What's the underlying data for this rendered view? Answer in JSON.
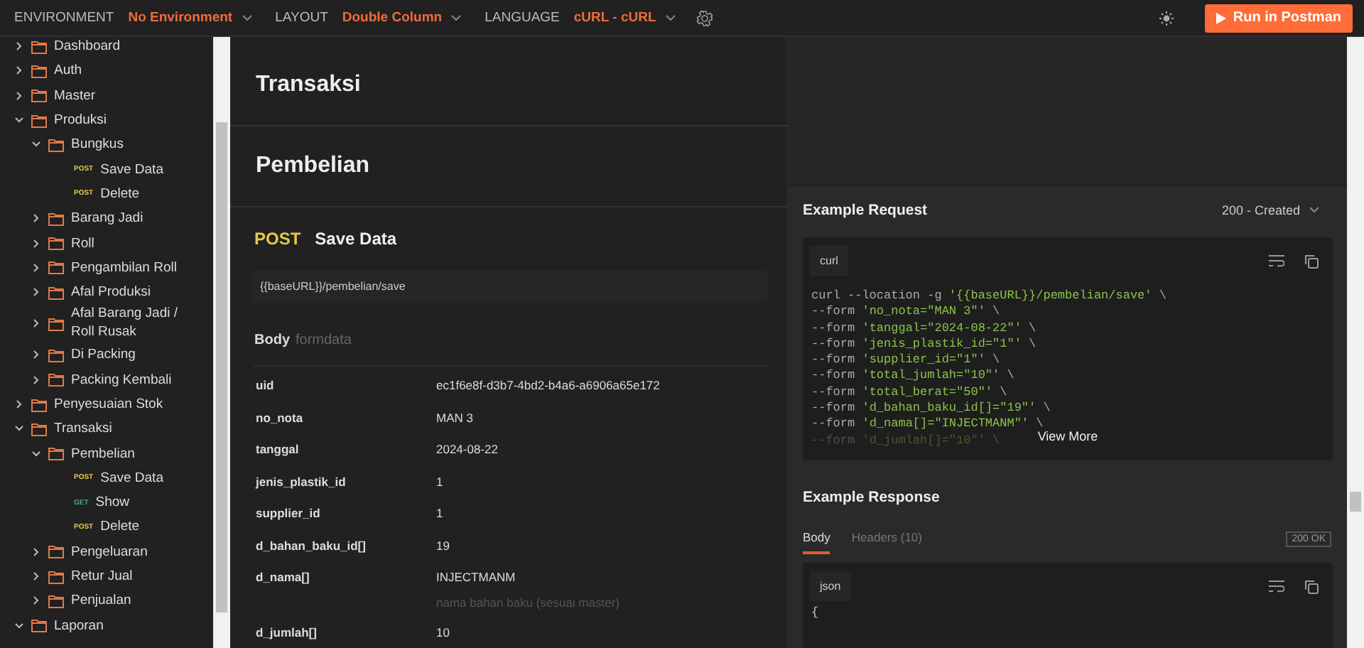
{
  "topbar": {
    "settings": [
      {
        "label": "ENVIRONMENT",
        "value": "No Environment"
      },
      {
        "label": "LAYOUT",
        "value": "Double Column"
      },
      {
        "label": "LANGUAGE",
        "value": "cURL - cURL"
      }
    ],
    "run_button": "Run in Postman"
  },
  "sidebar": {
    "items": [
      {
        "kind": "folder",
        "label": "Dashboard",
        "expanded": false
      },
      {
        "kind": "folder",
        "label": "Auth",
        "expanded": false
      },
      {
        "kind": "folder",
        "label": "Master",
        "expanded": false
      },
      {
        "kind": "folder",
        "label": "Produksi",
        "expanded": true,
        "children": [
          {
            "kind": "folder",
            "label": "Bungkus",
            "expanded": true,
            "children": [
              {
                "kind": "request",
                "method": "POST",
                "label": "Save Data"
              },
              {
                "kind": "request",
                "method": "POST",
                "label": "Delete"
              }
            ]
          },
          {
            "kind": "folder",
            "label": "Barang Jadi",
            "expanded": false
          },
          {
            "kind": "folder",
            "label": "Roll",
            "expanded": false
          },
          {
            "kind": "folder",
            "label": "Pengambilan Roll",
            "expanded": false
          },
          {
            "kind": "folder",
            "label": "Afal Produksi",
            "expanded": false
          },
          {
            "kind": "folder",
            "label": "Afal Barang Jadi / Roll Rusak",
            "expanded": false
          },
          {
            "kind": "folder",
            "label": "Di Packing",
            "expanded": false
          },
          {
            "kind": "folder",
            "label": "Packing Kembali",
            "expanded": false
          }
        ]
      },
      {
        "kind": "folder",
        "label": "Penyesuaian Stok",
        "expanded": false
      },
      {
        "kind": "folder",
        "label": "Transaksi",
        "expanded": true,
        "children": [
          {
            "kind": "folder",
            "label": "Pembelian",
            "expanded": true,
            "children": [
              {
                "kind": "request",
                "method": "POST",
                "label": "Save Data"
              },
              {
                "kind": "request",
                "method": "GET",
                "label": "Show"
              },
              {
                "kind": "request",
                "method": "POST",
                "label": "Delete"
              }
            ]
          },
          {
            "kind": "folder",
            "label": "Pengeluaran",
            "expanded": false
          },
          {
            "kind": "folder",
            "label": "Retur Jual",
            "expanded": false
          },
          {
            "kind": "folder",
            "label": "Penjualan",
            "expanded": false
          }
        ]
      },
      {
        "kind": "folder",
        "label": "Laporan",
        "expanded": true
      }
    ]
  },
  "main": {
    "sections": [
      "Transaksi",
      "Pembelian"
    ],
    "request": {
      "method": "POST",
      "name": "Save Data",
      "url": "{{baseURL}}/pembelian/save",
      "body_label": "Body",
      "body_type": "formdata",
      "params": [
        {
          "key": "uid",
          "value": "ec1f6e8f-d3b7-4bd2-b4a6-a6906a65e172"
        },
        {
          "key": "no_nota",
          "value": "MAN 3"
        },
        {
          "key": "tanggal",
          "value": "2024-08-22"
        },
        {
          "key": "jenis_plastik_id",
          "value": "1"
        },
        {
          "key": "supplier_id",
          "value": "1"
        },
        {
          "key": "d_bahan_baku_id[]",
          "value": "19"
        },
        {
          "key": "d_nama[]",
          "value": "INJECTMANM",
          "description": "nama bahan baku (sesuai master)"
        },
        {
          "key": "d_jumlah[]",
          "value": "10"
        }
      ]
    }
  },
  "example_request": {
    "title": "Example Request",
    "response_select": "200 - Created",
    "language": "curl",
    "lines": [
      {
        "flag": "curl --location -g",
        "arg": "'{{baseURL}}/pembelian/save'",
        "cont": "\\"
      },
      {
        "flag": "--form",
        "arg": "'no_nota=\"MAN 3\"'",
        "cont": "\\"
      },
      {
        "flag": "--form",
        "arg": "'tanggal=\"2024-08-22\"'",
        "cont": "\\"
      },
      {
        "flag": "--form",
        "arg": "'jenis_plastik_id=\"1\"'",
        "cont": "\\"
      },
      {
        "flag": "--form",
        "arg": "'supplier_id=\"1\"'",
        "cont": "\\"
      },
      {
        "flag": "--form",
        "arg": "'total_jumlah=\"10\"'",
        "cont": "\\"
      },
      {
        "flag": "--form",
        "arg": "'total_berat=\"50\"'",
        "cont": "\\"
      },
      {
        "flag": "--form",
        "arg": "'d_bahan_baku_id[]=\"19\"'",
        "cont": "\\"
      },
      {
        "flag": "--form",
        "arg": "'d_nama[]=\"INJECTMANM\"'",
        "cont": "\\"
      },
      {
        "flag": "--form",
        "arg": "'d_jumlah[]=\"10\"'",
        "cont": "\\"
      }
    ],
    "view_more": "View More"
  },
  "example_response": {
    "title": "Example Response",
    "tabs": [
      {
        "label": "Body",
        "selected": true
      },
      {
        "label": "Headers (10)",
        "selected": false
      }
    ],
    "status": "200 OK",
    "language": "json",
    "first_line": "{"
  }
}
